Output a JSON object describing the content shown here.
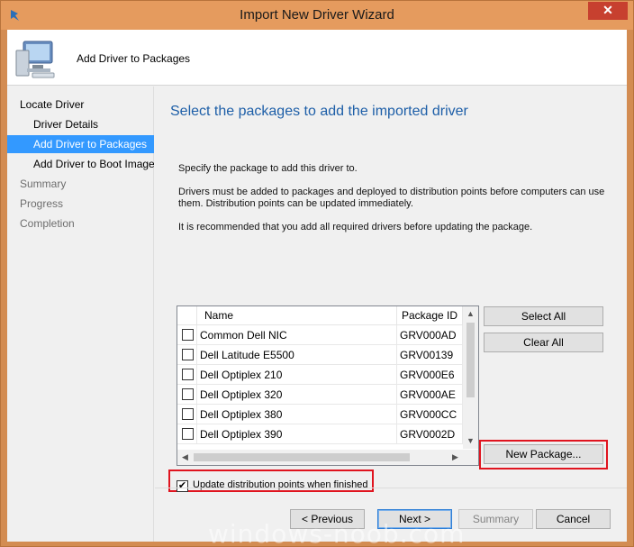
{
  "window": {
    "title": "Import New Driver Wizard",
    "close_glyph": "✕"
  },
  "header": {
    "title": "Add Driver to Packages"
  },
  "nav": {
    "items": [
      {
        "label": "Locate Driver"
      },
      {
        "label": "Driver Details"
      },
      {
        "label": "Add Driver to Packages"
      },
      {
        "label": "Add Driver to Boot Image"
      },
      {
        "label": "Summary"
      },
      {
        "label": "Progress"
      },
      {
        "label": "Completion"
      }
    ]
  },
  "page": {
    "heading": "Select the packages to add the imported driver",
    "instruction": "Specify the package to add this driver to.",
    "paragraph1": "Drivers must be added to packages and deployed to distribution points before computers can use them.  Distribution points can be updated immediately.",
    "paragraph2": "It is recommended that you add all required drivers before updating the package."
  },
  "grid": {
    "columns": {
      "name": "Name",
      "package_id": "Package ID"
    },
    "rows": [
      {
        "name": "Common Dell NIC",
        "package_id": "GRV000AD",
        "checked": false
      },
      {
        "name": "Dell Latitude E5500",
        "package_id": "GRV00139",
        "checked": false
      },
      {
        "name": "Dell Optiplex 210",
        "package_id": "GRV000E6",
        "checked": false
      },
      {
        "name": "Dell Optiplex 320",
        "package_id": "GRV000AE",
        "checked": false
      },
      {
        "name": "Dell Optiplex 380",
        "package_id": "GRV000CC",
        "checked": false
      },
      {
        "name": "Dell Optiplex 390",
        "package_id": "GRV0002D",
        "checked": false
      }
    ]
  },
  "buttons": {
    "select_all": "Select All",
    "clear_all": "Clear All",
    "new_package": "New Package...",
    "previous": "< Previous",
    "next": "Next >",
    "summary": "Summary",
    "cancel": "Cancel"
  },
  "update_checkbox": {
    "label": "Update distribution points when finished",
    "checked": true,
    "glyph": "✔"
  },
  "watermark": "windows-noob.com",
  "colors": {
    "title_bar": "#e59b5e",
    "selection": "#3399ff",
    "heading": "#1e5fa8",
    "highlight": "#e0141f"
  }
}
